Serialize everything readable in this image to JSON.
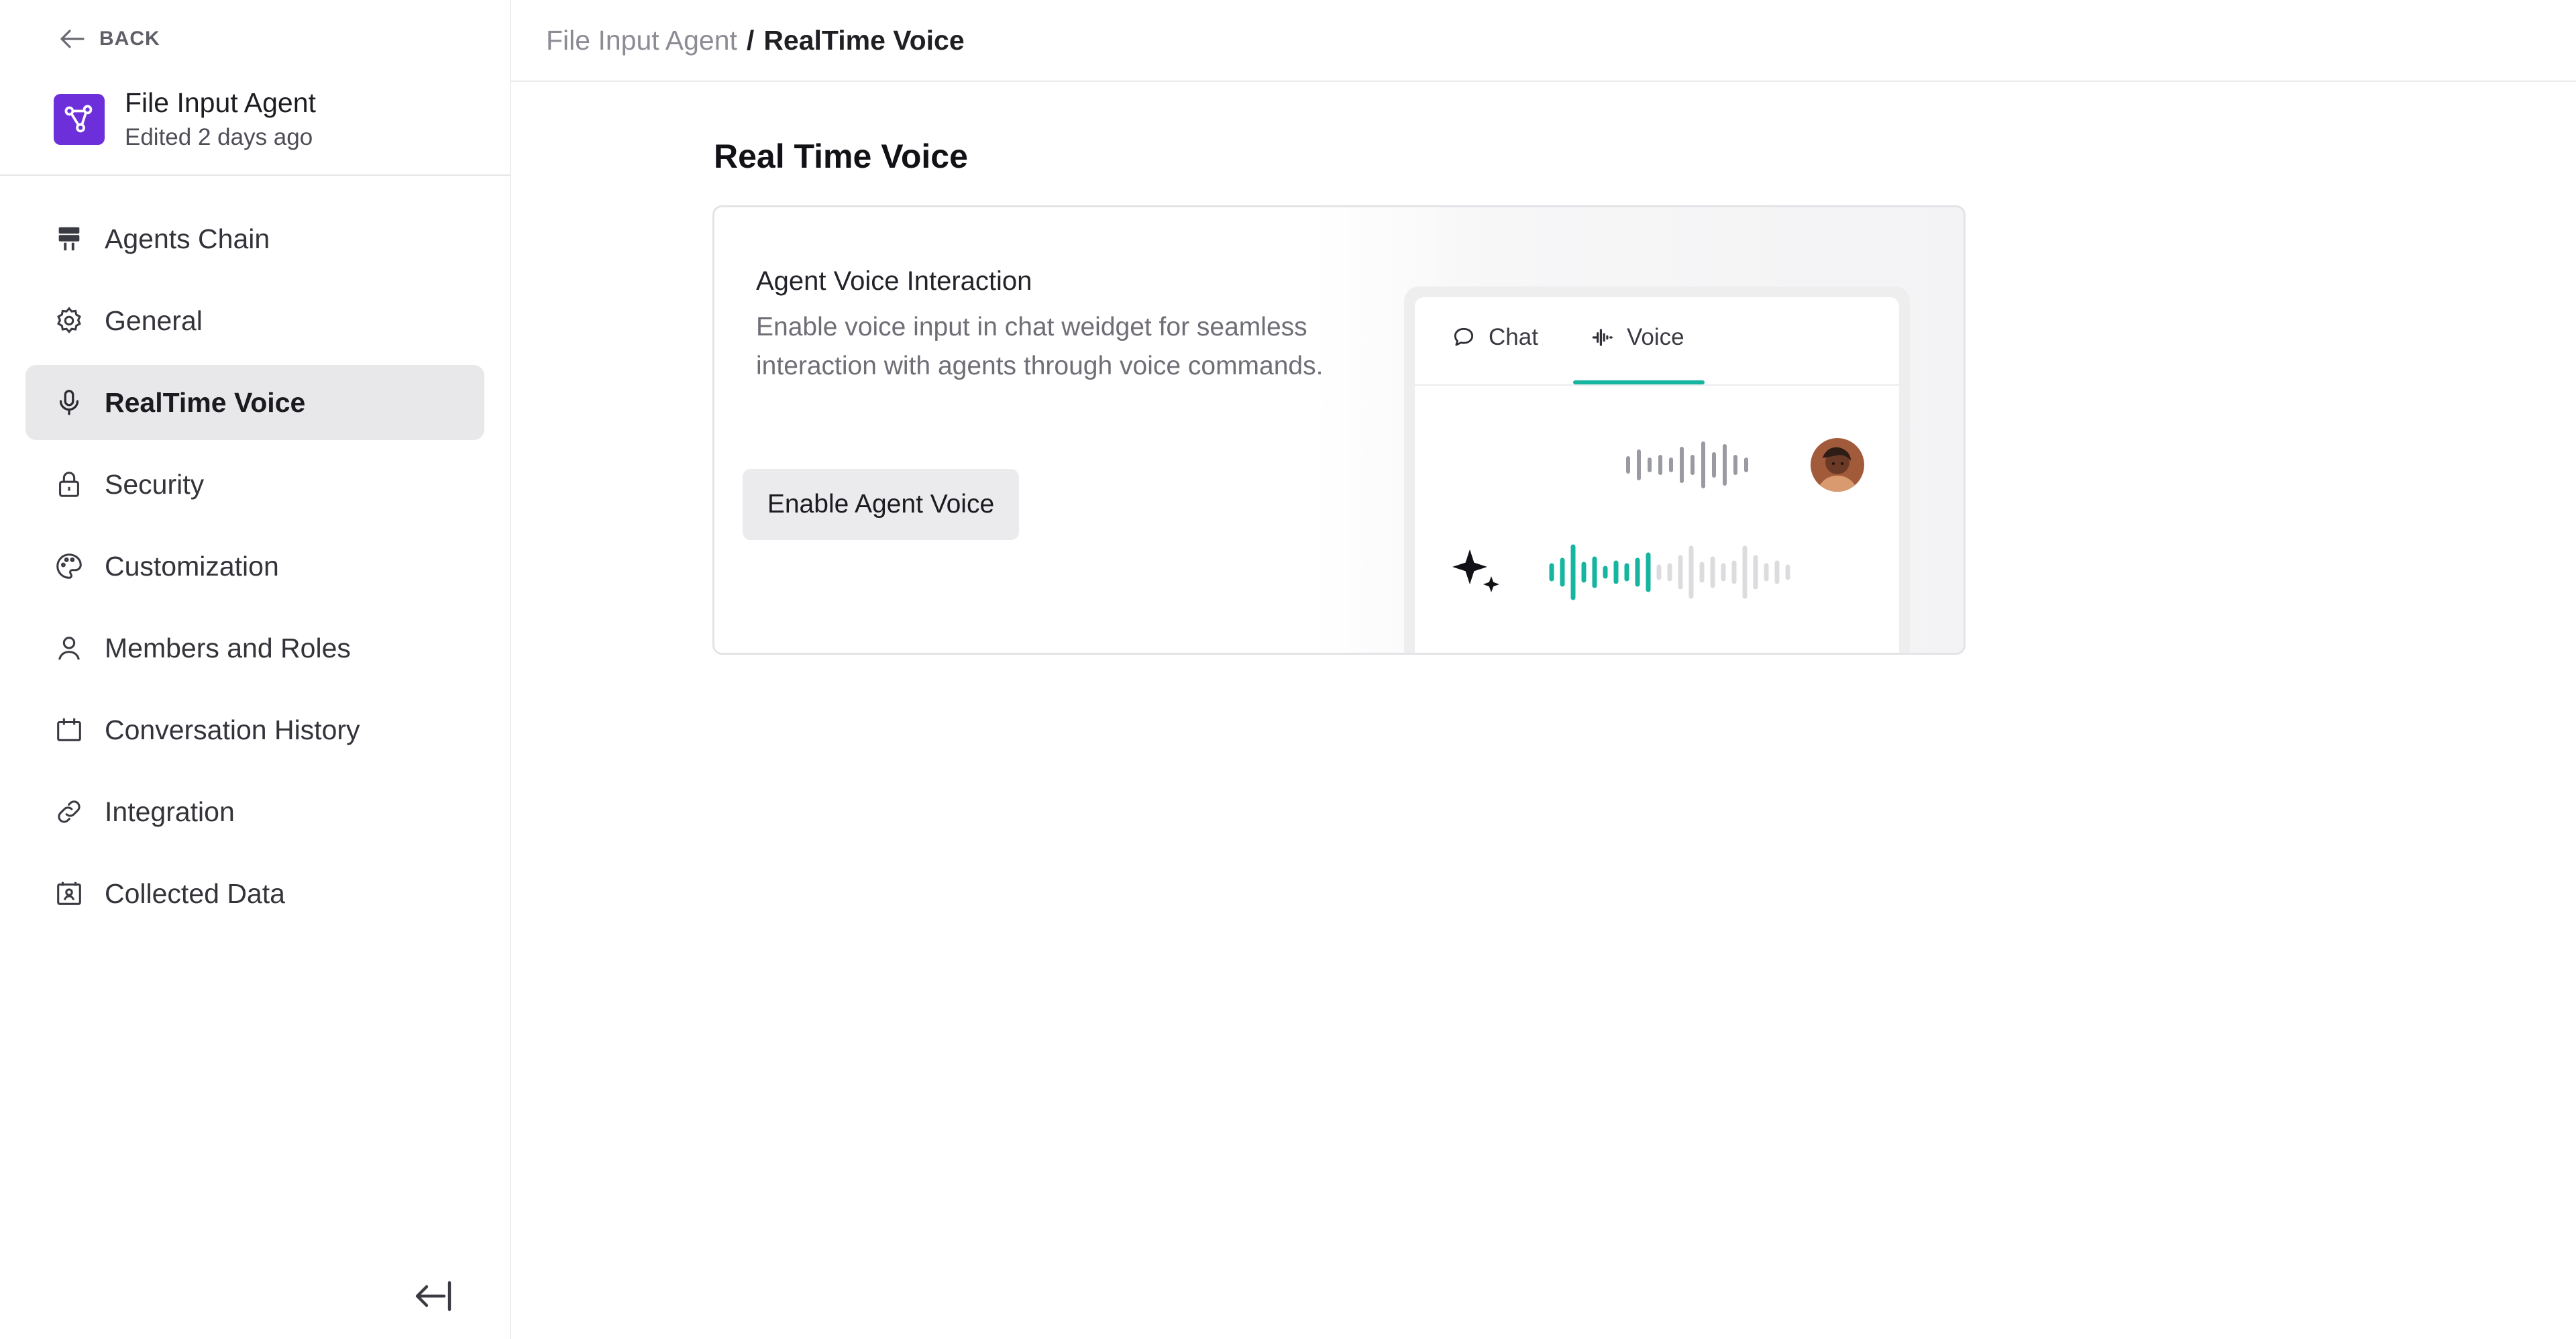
{
  "sidebar": {
    "back_label": "BACK",
    "agent_name": "File Input Agent",
    "agent_edited": "Edited 2 days ago",
    "agent_logo_color": "#6d2fd9",
    "items": [
      {
        "label": "Agents Chain",
        "icon": "agents-chain-icon",
        "active": false
      },
      {
        "label": "General",
        "icon": "gear-icon",
        "active": false
      },
      {
        "label": "RealTime Voice",
        "icon": "microphone-icon",
        "active": true
      },
      {
        "label": "Security",
        "icon": "lock-icon",
        "active": false
      },
      {
        "label": "Customization",
        "icon": "palette-icon",
        "active": false
      },
      {
        "label": "Members and Roles",
        "icon": "user-icon",
        "active": false
      },
      {
        "label": "Conversation History",
        "icon": "calendar-icon",
        "active": false
      },
      {
        "label": "Integration",
        "icon": "link-icon",
        "active": false
      },
      {
        "label": "Collected Data",
        "icon": "contact-card-icon",
        "active": false
      }
    ]
  },
  "breadcrumb": {
    "parent": "File Input Agent",
    "separator": "/",
    "current": "RealTime Voice"
  },
  "main": {
    "title": "Real Time Voice",
    "card": {
      "title": "Agent Voice Interaction",
      "description": "Enable voice input in chat weidget for seamless interaction with agents through voice commands.",
      "button_label": "Enable Agent Voice"
    },
    "preview": {
      "tabs": [
        {
          "label": "Chat",
          "icon": "chat-bubble-icon"
        },
        {
          "label": "Voice",
          "icon": "voice-wave-icon"
        }
      ],
      "active_tab": "Voice",
      "accent_color": "#16b5a0"
    }
  }
}
